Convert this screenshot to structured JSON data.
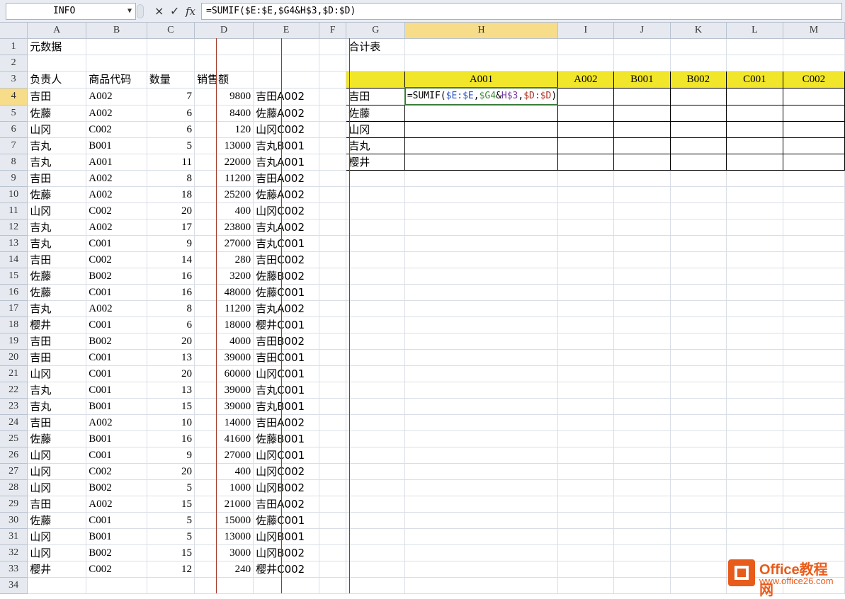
{
  "formula_bar": {
    "name_box": "INFO",
    "cancel_icon": "×",
    "enter_icon": "✓",
    "fx_label": "fx",
    "formula": "=SUMIF($E:$E,$G4&H$3,$D:$D)"
  },
  "columns": [
    "A",
    "B",
    "C",
    "D",
    "E",
    "F",
    "G",
    "H",
    "I",
    "J",
    "K",
    "L",
    "M"
  ],
  "rows": [
    {
      "n": "1",
      "a": "元数据",
      "b": "",
      "c": "",
      "d": "",
      "e": "",
      "g": "合计表"
    },
    {
      "n": "2",
      "a": "",
      "b": "",
      "c": "",
      "d": "",
      "e": "",
      "g": ""
    },
    {
      "n": "3",
      "a": "负责人",
      "b": "商品代码",
      "c": "数量",
      "d": "销售额",
      "e": "",
      "g": ""
    },
    {
      "n": "4",
      "a": "吉田",
      "b": "A002",
      "c": "7",
      "d": "9800",
      "e": "吉田A002",
      "g": "吉田"
    },
    {
      "n": "5",
      "a": "佐藤",
      "b": "A002",
      "c": "6",
      "d": "8400",
      "e": "佐藤A002",
      "g": "佐藤"
    },
    {
      "n": "6",
      "a": "山冈",
      "b": "C002",
      "c": "6",
      "d": "120",
      "e": "山冈C002",
      "g": "山冈"
    },
    {
      "n": "7",
      "a": "吉丸",
      "b": "B001",
      "c": "5",
      "d": "13000",
      "e": "吉丸B001",
      "g": "吉丸"
    },
    {
      "n": "8",
      "a": "吉丸",
      "b": "A001",
      "c": "11",
      "d": "22000",
      "e": "吉丸A001",
      "g": "樱井"
    },
    {
      "n": "9",
      "a": "吉田",
      "b": "A002",
      "c": "8",
      "d": "11200",
      "e": "吉田A002",
      "g": ""
    },
    {
      "n": "10",
      "a": "佐藤",
      "b": "A002",
      "c": "18",
      "d": "25200",
      "e": "佐藤A002",
      "g": ""
    },
    {
      "n": "11",
      "a": "山冈",
      "b": "C002",
      "c": "20",
      "d": "400",
      "e": "山冈C002",
      "g": ""
    },
    {
      "n": "12",
      "a": "吉丸",
      "b": "A002",
      "c": "17",
      "d": "23800",
      "e": "吉丸A002",
      "g": ""
    },
    {
      "n": "13",
      "a": "吉丸",
      "b": "C001",
      "c": "9",
      "d": "27000",
      "e": "吉丸C001",
      "g": ""
    },
    {
      "n": "14",
      "a": "吉田",
      "b": "C002",
      "c": "14",
      "d": "280",
      "e": "吉田C002",
      "g": ""
    },
    {
      "n": "15",
      "a": "佐藤",
      "b": "B002",
      "c": "16",
      "d": "3200",
      "e": "佐藤B002",
      "g": ""
    },
    {
      "n": "16",
      "a": "佐藤",
      "b": "C001",
      "c": "16",
      "d": "48000",
      "e": "佐藤C001",
      "g": ""
    },
    {
      "n": "17",
      "a": "吉丸",
      "b": "A002",
      "c": "8",
      "d": "11200",
      "e": "吉丸A002",
      "g": ""
    },
    {
      "n": "18",
      "a": "樱井",
      "b": "C001",
      "c": "6",
      "d": "18000",
      "e": "樱井C001",
      "g": ""
    },
    {
      "n": "19",
      "a": "吉田",
      "b": "B002",
      "c": "20",
      "d": "4000",
      "e": "吉田B002",
      "g": ""
    },
    {
      "n": "20",
      "a": "吉田",
      "b": "C001",
      "c": "13",
      "d": "39000",
      "e": "吉田C001",
      "g": ""
    },
    {
      "n": "21",
      "a": "山冈",
      "b": "C001",
      "c": "20",
      "d": "60000",
      "e": "山冈C001",
      "g": ""
    },
    {
      "n": "22",
      "a": "吉丸",
      "b": "C001",
      "c": "13",
      "d": "39000",
      "e": "吉丸C001",
      "g": ""
    },
    {
      "n": "23",
      "a": "吉丸",
      "b": "B001",
      "c": "15",
      "d": "39000",
      "e": "吉丸B001",
      "g": ""
    },
    {
      "n": "24",
      "a": "吉田",
      "b": "A002",
      "c": "10",
      "d": "14000",
      "e": "吉田A002",
      "g": ""
    },
    {
      "n": "25",
      "a": "佐藤",
      "b": "B001",
      "c": "16",
      "d": "41600",
      "e": "佐藤B001",
      "g": ""
    },
    {
      "n": "26",
      "a": "山冈",
      "b": "C001",
      "c": "9",
      "d": "27000",
      "e": "山冈C001",
      "g": ""
    },
    {
      "n": "27",
      "a": "山冈",
      "b": "C002",
      "c": "20",
      "d": "400",
      "e": "山冈C002",
      "g": ""
    },
    {
      "n": "28",
      "a": "山冈",
      "b": "B002",
      "c": "5",
      "d": "1000",
      "e": "山冈B002",
      "g": ""
    },
    {
      "n": "29",
      "a": "吉田",
      "b": "A002",
      "c": "15",
      "d": "21000",
      "e": "吉田A002",
      "g": ""
    },
    {
      "n": "30",
      "a": "佐藤",
      "b": "C001",
      "c": "5",
      "d": "15000",
      "e": "佐藤C001",
      "g": ""
    },
    {
      "n": "31",
      "a": "山冈",
      "b": "B001",
      "c": "5",
      "d": "13000",
      "e": "山冈B001",
      "g": ""
    },
    {
      "n": "32",
      "a": "山冈",
      "b": "B002",
      "c": "15",
      "d": "3000",
      "e": "山冈B002",
      "g": ""
    },
    {
      "n": "33",
      "a": "樱井",
      "b": "C002",
      "c": "12",
      "d": "240",
      "e": "樱井C002",
      "g": ""
    },
    {
      "n": "34",
      "a": "",
      "b": "",
      "c": "",
      "d": "",
      "e": "",
      "g": ""
    }
  ],
  "summary_headers": [
    "A001",
    "A002",
    "B001",
    "B002",
    "C001",
    "C002"
  ],
  "editing_formula_parts": {
    "p1": "=SUMIF(",
    "p2": "$E:$E",
    "p3": ",",
    "p4": "$G4",
    "p5": "&",
    "p6": "H$3",
    "p7": ",",
    "p8": "$D:$D",
    "p9": ")"
  },
  "colors": {
    "header_fill": "#f2e62b",
    "ref_blue": "#2653c6",
    "ref_green": "#3e8b3a",
    "ref_purple": "#7a3aa0",
    "ref_red": "#b0301e"
  },
  "logo": {
    "title": "Office教程网",
    "url": "www.office26.com",
    "icon": "office-logo-icon"
  }
}
